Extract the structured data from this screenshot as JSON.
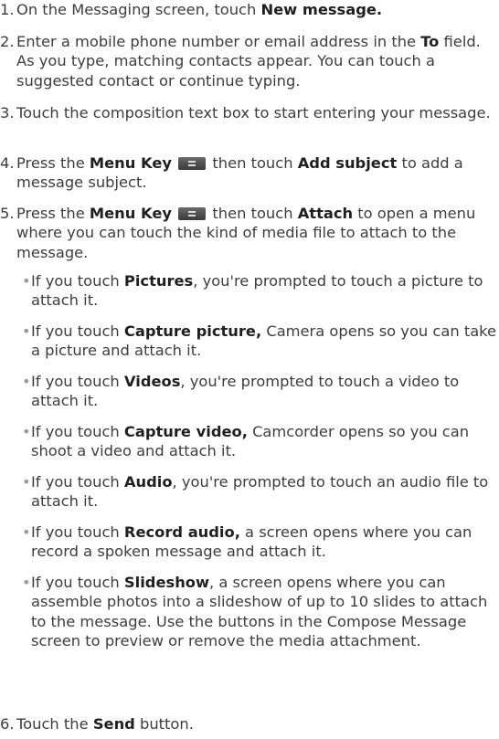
{
  "steps": [
    {
      "num": "1.",
      "a": "On the Messaging screen, touch ",
      "b1": "New message.",
      "c": ""
    },
    {
      "num": "2.",
      "a": "Enter a mobile phone number or email address in the ",
      "b1": "To",
      "c": " field. As you type, matching contacts appear. You can touch a suggested contact or continue typing."
    },
    {
      "num": "3.",
      "a": "Touch the composition text box to start entering your message.",
      "b1": "",
      "c": ""
    },
    {
      "num": "4.",
      "a": "Press the ",
      "b1": "Menu Key",
      "c": " then touch ",
      "b2": "Add subject",
      "d": " to add a message subject."
    },
    {
      "num": "5.",
      "a": "Press the ",
      "b1": "Menu Key",
      "c": " then touch ",
      "b2": "Attach",
      "d": " to open a menu where you can touch the kind of media file to attach to the message."
    },
    {
      "num": "6.",
      "a": "Touch the ",
      "b1": "Send",
      "c": " button."
    }
  ],
  "bullets": [
    {
      "a": "If you touch ",
      "b": "Pictures",
      "c": ", you're prompted to touch a picture to attach it."
    },
    {
      "a": "If you touch ",
      "b": "Capture picture,",
      "c": " Camera opens so you can take a picture and attach it."
    },
    {
      "a": "If you touch ",
      "b": "Videos",
      "c": ", you're prompted to touch a video to attach it."
    },
    {
      "a": "If you touch ",
      "b": "Capture video,",
      "c": " Camcorder opens so you can shoot a video and attach it."
    },
    {
      "a": "If you touch ",
      "b": "Audio",
      "c": ", you're prompted to touch an audio file to attach it."
    },
    {
      "a": "If you touch ",
      "b": "Record audio,",
      "c": " a screen opens where you can record a spoken message and attach it."
    },
    {
      "a": "If you touch ",
      "b": "Slideshow",
      "c": ", a screen opens where you can assemble photos into a slideshow of up to 10 slides to attach to the message. Use the buttons in the Compose Message screen to preview or remove the media attachment."
    }
  ],
  "bullet_char": "•",
  "icons": {
    "menu_key": "menu-key-icon"
  }
}
